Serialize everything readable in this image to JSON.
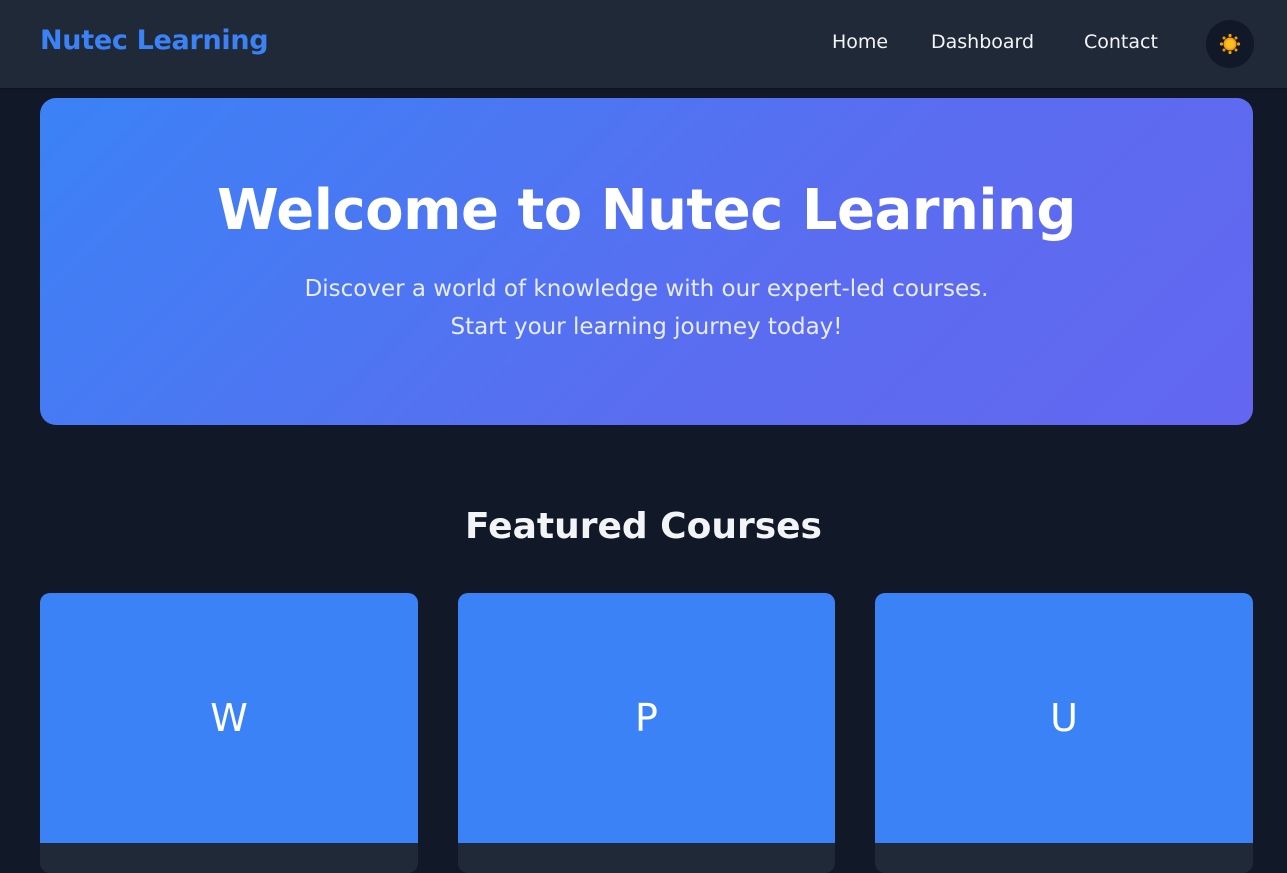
{
  "nav": {
    "brand": "Nutec Learning",
    "links": [
      "Home",
      "Dashboard",
      "Contact"
    ],
    "theme_icon": "sun-icon"
  },
  "hero": {
    "title": "Welcome to Nutec Learning",
    "subtitle_line1": "Discover a world of knowledge with our expert-led courses.",
    "subtitle_line2": "Start your learning journey today!"
  },
  "featured": {
    "title": "Featured Courses",
    "courses": [
      {
        "initial": "W"
      },
      {
        "initial": "P"
      },
      {
        "initial": "U"
      }
    ]
  },
  "colors": {
    "accent": "#3b82f6",
    "gradient_end": "#6366f1",
    "background": "#111827",
    "surface": "#1f2937"
  }
}
